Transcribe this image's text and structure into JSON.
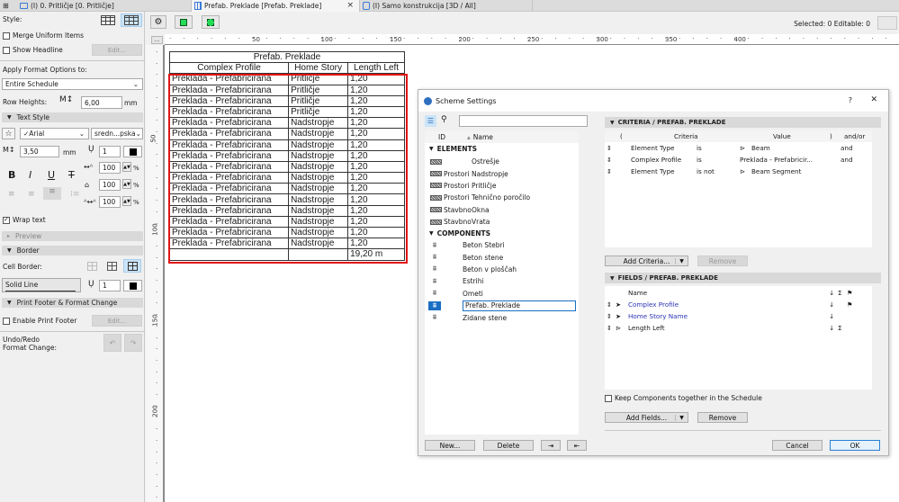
{
  "tabs": [
    {
      "label": "(I) 0. Pritličje [0. Pritličje]",
      "icon": "floor-plan-icon"
    },
    {
      "label": "Prefab. Preklade [Prefab. Preklade]",
      "icon": "schedule-icon",
      "active": true
    },
    {
      "label": "(I) Samo konstrukcija [3D / All]",
      "icon": "3d-view-icon"
    }
  ],
  "status": {
    "selected_editable": "Selected: 0  Editable: 0"
  },
  "left_panel": {
    "style_label": "Style:",
    "merge_uniform": "Merge Uniform Items",
    "show_headline": "Show Headline",
    "edit_label": "Edit...",
    "apply_format_label": "Apply Format Options to:",
    "apply_format_value": "Entire Schedule",
    "row_heights_label": "Row Heights:",
    "row_heights_value": "6,00",
    "row_heights_unit": "mm",
    "text_style_section": "Text Style",
    "font_value": "✓Arial",
    "font_style_value": "sredn...pska",
    "text_size_value": "3,50",
    "text_size_unit": "mm",
    "pen_value": "1",
    "width_pct": "100",
    "height_pct": "100",
    "spacing_pct": "100",
    "pct": "%",
    "bold": "B",
    "italic": "I",
    "underline": "U",
    "strike": "T",
    "wrap_text": "Wrap text",
    "wrap_text_checked": true,
    "preview_section": "Preview",
    "border_section": "Border",
    "cell_border_label": "Cell Border:",
    "line_type_value": "Solid Line",
    "border_pen_value": "1",
    "print_footer_section": "Print Footer & Format Change",
    "enable_print_footer": "Enable Print Footer",
    "undo_redo_label": "Undo/Redo\nFormat Change:"
  },
  "ruler": {
    "h_labels": [
      "50",
      "100",
      "150",
      "200",
      "250",
      "300",
      "350",
      "400"
    ],
    "v_labels": [
      "50",
      "100",
      "150",
      "200"
    ]
  },
  "schedule": {
    "title": "Prefab. Preklade",
    "columns": [
      "Complex Profile",
      "Home Story",
      "Length Left"
    ],
    "rows": [
      [
        "Preklada - Prefabricirana",
        "Pritličje",
        "1,20"
      ],
      [
        "Preklada - Prefabricirana",
        "Pritličje",
        "1,20"
      ],
      [
        "Preklada - Prefabricirana",
        "Pritličje",
        "1,20"
      ],
      [
        "Preklada - Prefabricirana",
        "Pritličje",
        "1,20"
      ],
      [
        "Preklada - Prefabricirana",
        "Nadstropje",
        "1,20"
      ],
      [
        "Preklada - Prefabricirana",
        "Nadstropje",
        "1,20"
      ],
      [
        "Preklada - Prefabricirana",
        "Nadstropje",
        "1,20"
      ],
      [
        "Preklada - Prefabricirana",
        "Nadstropje",
        "1,20"
      ],
      [
        "Preklada - Prefabricirana",
        "Nadstropje",
        "1,20"
      ],
      [
        "Preklada - Prefabricirana",
        "Nadstropje",
        "1,20"
      ],
      [
        "Preklada - Prefabricirana",
        "Nadstropje",
        "1,20"
      ],
      [
        "Preklada - Prefabricirana",
        "Nadstropje",
        "1,20"
      ],
      [
        "Preklada - Prefabricirana",
        "Nadstropje",
        "1,20"
      ],
      [
        "Preklada - Prefabricirana",
        "Nadstropje",
        "1,20"
      ],
      [
        "Preklada - Prefabricirana",
        "Nadstropje",
        "1,20"
      ],
      [
        "Preklada - Prefabricirana",
        "Nadstropje",
        "1,20"
      ]
    ],
    "total": [
      "",
      "",
      "19,20 m"
    ]
  },
  "dialog": {
    "title": "Scheme Settings",
    "help": "?",
    "close": "✕",
    "list_header_id": "ID",
    "list_header_name": "Name",
    "elements_group": "ELEMENTS",
    "elements": [
      {
        "id": "",
        "name": "Ostrešje"
      },
      {
        "id": "Prostori",
        "name": "Nadstropje"
      },
      {
        "id": "Prostori",
        "name": "Pritličje"
      },
      {
        "id": "Prostori",
        "name": "Tehnično poročilo"
      },
      {
        "id": "Stavbno",
        "name": "Okna"
      },
      {
        "id": "Stavbno",
        "name": "Vrata"
      }
    ],
    "components_group": "COMPONENTS",
    "components": [
      {
        "name": "Beton Stebri"
      },
      {
        "name": "Beton stene"
      },
      {
        "name": "Beton v ploščah"
      },
      {
        "name": "Estrihi"
      },
      {
        "name": "Ometi"
      },
      {
        "name": "Prefab. Preklade",
        "selected": true
      },
      {
        "name": "Zidane stene"
      }
    ],
    "new_button": "New...",
    "delete_button": "Delete",
    "criteria_section": "CRITERIA /  PREFAB. PREKLADE",
    "criteria_headers": {
      "open": "(",
      "criteria": "Criteria",
      "value": "Value",
      "close": ")",
      "andor": "and/or"
    },
    "criteria": [
      {
        "field": "Element Type",
        "op": "is",
        "value": "Beam",
        "value_icon": "beam-icon",
        "andor": "and"
      },
      {
        "field": "Complex Profile",
        "op": "is",
        "value": "Preklada - Prefabricir...",
        "value_icon": "",
        "andor": "and"
      },
      {
        "field": "Element Type",
        "op": "is not",
        "value": "Beam Segment",
        "value_icon": "beam-segment-icon",
        "andor": ""
      }
    ],
    "add_criteria_button": "Add Criteria...",
    "remove_criteria_button": "Remove",
    "fields_section": "FIELDS /  PREFAB. PREKLADE",
    "fields_header_name": "Name",
    "fields": [
      {
        "name": "Complex Profile",
        "icon": "cursor-icon",
        "sort": "↓",
        "sum": "",
        "flag": "⚑",
        "linked": true
      },
      {
        "name": "Home Story Name",
        "icon": "cursor-icon",
        "sort": "↓",
        "sum": "",
        "flag": "",
        "linked": true
      },
      {
        "name": "Length Left",
        "icon": "beam-icon",
        "sort": "↓",
        "sum": "Σ",
        "flag": "",
        "linked": false
      }
    ],
    "keep_components": "Keep Components together in the Schedule",
    "add_fields_button": "Add Fields...",
    "remove_fields_button": "Remove",
    "cancel_button": "Cancel",
    "ok_button": "OK"
  }
}
